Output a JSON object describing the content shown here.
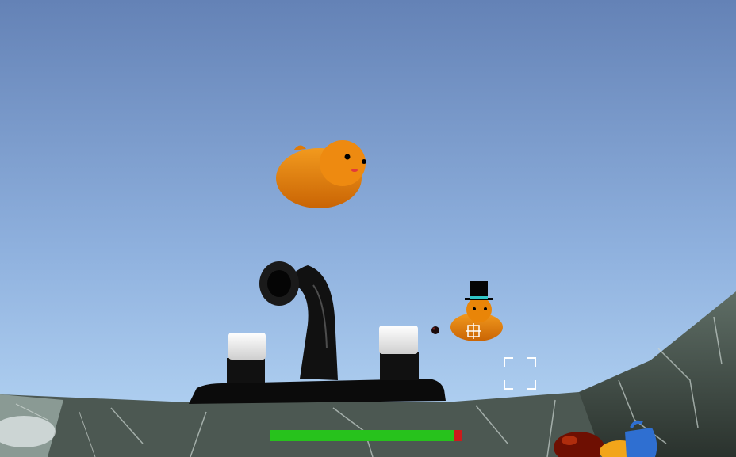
{
  "hud": {
    "health_fraction": 0.96,
    "health_color": "#27c21c",
    "damage_color": "#cc1b1b"
  },
  "colors": {
    "sky_top": "#6482b6",
    "sky_bottom": "#b2d4f4",
    "duck": "#e07a06",
    "faucet": "#0b0b0b",
    "marble": "#3f4a44"
  },
  "icons": {
    "reticle": "target-frame-icon",
    "crosshair": "crosshair-icon"
  }
}
